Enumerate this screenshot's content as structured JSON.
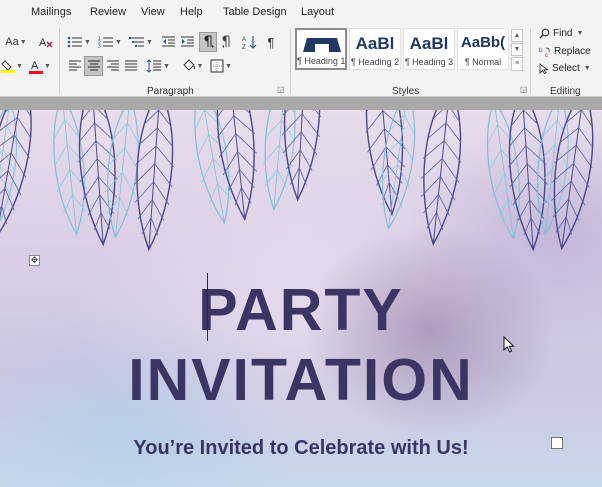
{
  "menu": {
    "items": [
      {
        "key": "mailings",
        "label": "Mailings"
      },
      {
        "key": "review",
        "label": "Review"
      },
      {
        "key": "view",
        "label": "View"
      },
      {
        "key": "help",
        "label": "Help"
      },
      {
        "key": "table_design",
        "label": "Table Design"
      },
      {
        "key": "layout",
        "label": "Layout"
      }
    ]
  },
  "ribbon": {
    "font_group": {
      "change_case_label": "Aa",
      "highlight_color": "#ffff00",
      "font_color": "#e81123"
    },
    "paragraph": {
      "group_label": "Paragraph"
    },
    "styles": {
      "group_label": "Styles",
      "items": [
        {
          "sample": "",
          "name": "¶ Heading 1",
          "selected": true
        },
        {
          "sample": "AaBl",
          "name": "¶ Heading 2"
        },
        {
          "sample": "AaBl",
          "name": "¶ Heading 3"
        },
        {
          "sample": "AaBb(",
          "name": "¶ Normal"
        }
      ]
    },
    "editing": {
      "group_label": "Editing",
      "find_label": "Find",
      "replace_label": "Replace",
      "select_label": "Select"
    }
  },
  "document": {
    "title_line1": "PARTY",
    "title_line2": "INVITATION",
    "subtitle": "You’re Invited to Celebrate with Us!",
    "title_color": "#3b3563"
  }
}
